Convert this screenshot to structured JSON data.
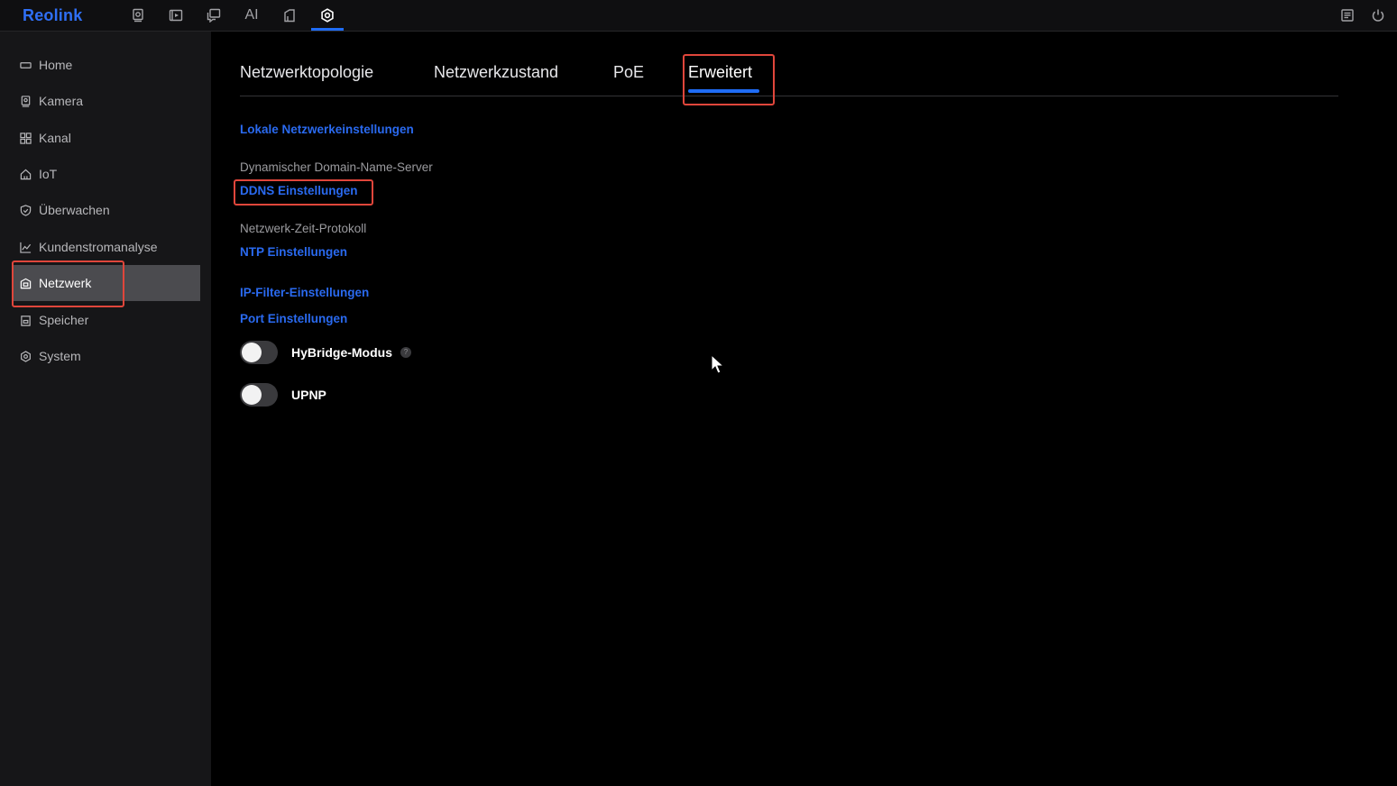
{
  "app": {
    "logo": "Reolink"
  },
  "topbar": {
    "icons": [
      "live-view-icon",
      "playback-icon",
      "message-icon",
      "ai-icon",
      "device-icon",
      "settings-icon"
    ],
    "ai_label": "AI",
    "active": "settings-icon",
    "right_icons": [
      "notes-icon",
      "power-icon"
    ]
  },
  "sidebar": {
    "items": [
      {
        "label": "Home",
        "icon": "home-icon"
      },
      {
        "label": "Kamera",
        "icon": "camera-icon"
      },
      {
        "label": "Kanal",
        "icon": "grid-icon"
      },
      {
        "label": "IoT",
        "icon": "house-icon"
      },
      {
        "label": "Überwachen",
        "icon": "shield-icon"
      },
      {
        "label": "Kundenstromanalyse",
        "icon": "chart-icon"
      },
      {
        "label": "Netzwerk",
        "icon": "network-icon"
      },
      {
        "label": "Speicher",
        "icon": "storage-icon"
      },
      {
        "label": "System",
        "icon": "system-icon"
      }
    ],
    "active": "Netzwerk"
  },
  "tabs": [
    {
      "label": "Netzwerktopologie"
    },
    {
      "label": "Netzwerkzustand"
    },
    {
      "label": "PoE"
    },
    {
      "label": "Erweitert"
    }
  ],
  "active_tab": "Erweitert",
  "content": {
    "local_network_link": "Lokale Netzwerkeinstellungen",
    "ddns_label": "Dynamischer Domain-Name-Server",
    "ddns_link": "DDNS Einstellungen",
    "ntp_label": "Netzwerk-Zeit-Protokoll",
    "ntp_link": "NTP Einstellungen",
    "ip_filter_link": "IP-Filter-Einstellungen",
    "port_link": "Port Einstellungen",
    "hybridge_label": "HyBridge-Modus",
    "hybridge_help": "?",
    "hybridge_enabled": false,
    "upnp_label": "UPNP",
    "upnp_enabled": false
  },
  "colors": {
    "accent": "#1f6cf5",
    "link": "#2a6af0",
    "highlight": "#e0463b",
    "sidebar_bg": "#161618",
    "sidebar_active": "#4b4b4f"
  }
}
